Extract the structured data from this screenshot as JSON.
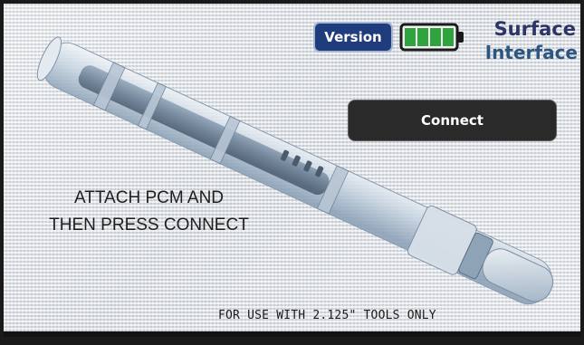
{
  "header": {
    "version_label": "Version",
    "battery_level": 1.0,
    "brand": {
      "line1": "Surface",
      "line2": "Interface"
    }
  },
  "actions": {
    "connect_label": "Connect"
  },
  "instruction": {
    "line1": "ATTACH PCM AND",
    "line2": "THEN PRESS CONNECT"
  },
  "footer": {
    "note": "FOR USE WITH 2.125\" TOOLS ONLY"
  },
  "colors": {
    "version_button": "#1f3c7d",
    "battery_fill": "#2fa43c",
    "connect_button": "#2a2a2a",
    "brand_text": "#2c3566"
  },
  "icons": {
    "battery": "battery-full-icon"
  }
}
